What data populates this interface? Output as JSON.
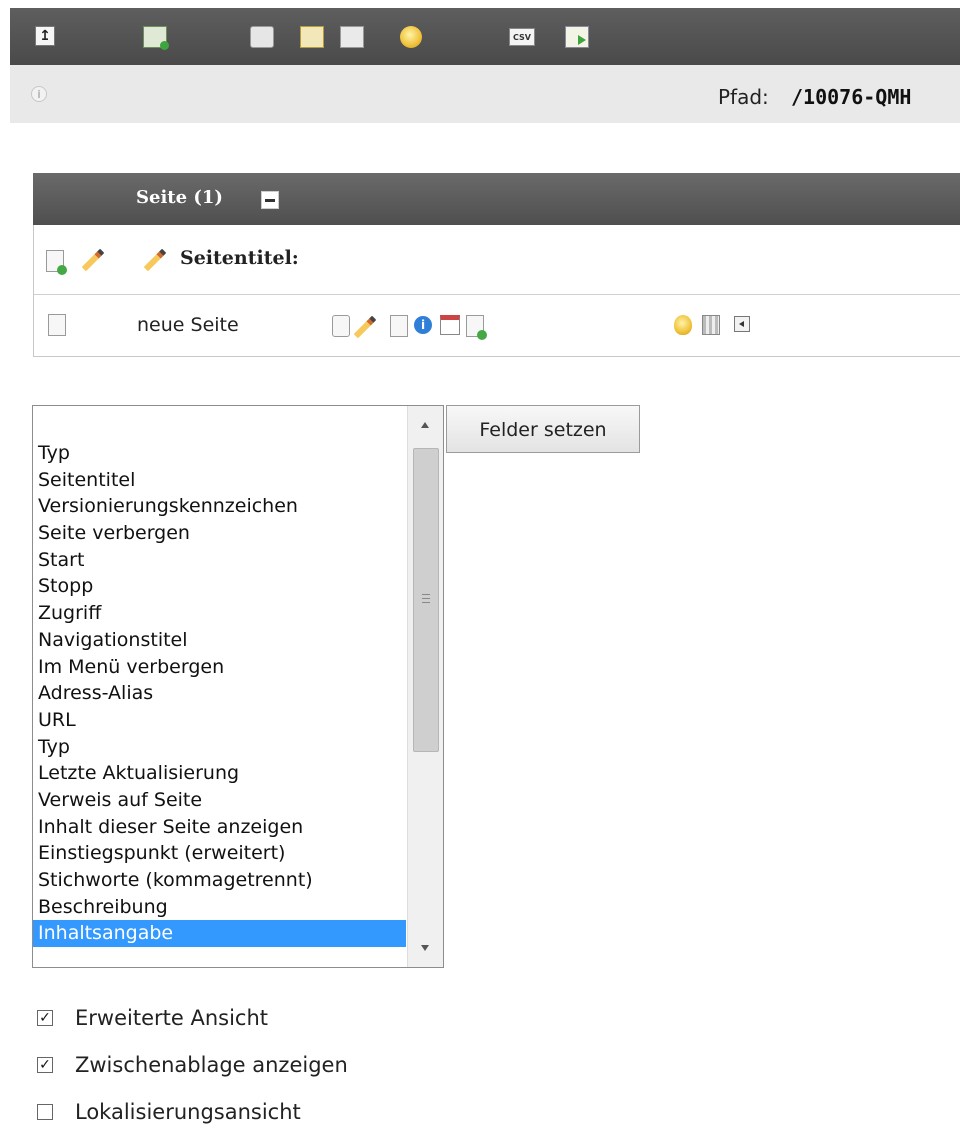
{
  "toolbar": {
    "icons": [
      "level-up-icon",
      "new-record-icon",
      "view-icon",
      "edit-icon",
      "move-icon",
      "lightbulb-icon",
      "csv-export-icon",
      "export-icon"
    ],
    "csv_text": "CSV"
  },
  "pathbar": {
    "label": "Pfad:",
    "value": "/10076-QMH"
  },
  "pages_section": {
    "title": "Seite (1)",
    "column_label": "Seitentitel:",
    "rows": [
      {
        "name": "neue Seite"
      }
    ]
  },
  "field_selector": {
    "options": [
      "Typ",
      "Seitentitel",
      "Versionierungskennzeichen",
      "Seite verbergen",
      "Start",
      "Stopp",
      "Zugriff",
      "Navigationstitel",
      "Im Menü verbergen",
      "Adress-Alias",
      "URL",
      "Typ",
      "Letzte Aktualisierung",
      "Verweis auf Seite",
      "Inhalt dieser Seite anzeigen",
      "Einstiegspunkt (erweitert)",
      "Stichworte (kommagetrennt)",
      "Beschreibung",
      "Inhaltsangabe"
    ],
    "selected": "Inhaltsangabe",
    "button_label": "Felder setzen"
  },
  "options": {
    "extended_view": {
      "label": "Erweiterte Ansicht",
      "checked": true
    },
    "show_clipboard": {
      "label": "Zwischenablage anzeigen",
      "checked": true
    },
    "localization_view": {
      "label": "Lokalisierungsansicht",
      "checked": false
    }
  },
  "colors": {
    "toolbar_bg": "#555555",
    "section_header_bg": "#5c5c5c",
    "selection_bg": "#3399ff"
  }
}
